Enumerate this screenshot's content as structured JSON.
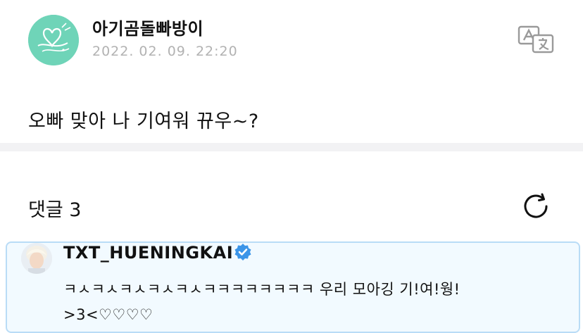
{
  "post": {
    "author": "아기곰돌빠방이",
    "date": "2022. 02. 09. 22:20",
    "body": "오빠 맞아 나 기여워 뀨우~?"
  },
  "icons": {
    "translate": "translate-icon",
    "refresh": "refresh-icon",
    "verified": "verified-badge-icon"
  },
  "comments": {
    "title": "댓글 3",
    "items": [
      {
        "author": "TXT_HUENINGKAI",
        "text": "ㅋㅅㅋㅅㅋㅅㅋㅅㅋㅅㅋㅋㅋㅋㅋㅋㅋㅋ 우리 모아깅 기!여!웡!\n>3<♡♡♡♡"
      }
    ]
  },
  "colors": {
    "avatar_bg": "#6fd4b8",
    "comment_bg": "#f2faff",
    "comment_border": "#b9dcf6",
    "verified": "#3b95e8",
    "date_text": "#b2b2b2"
  }
}
